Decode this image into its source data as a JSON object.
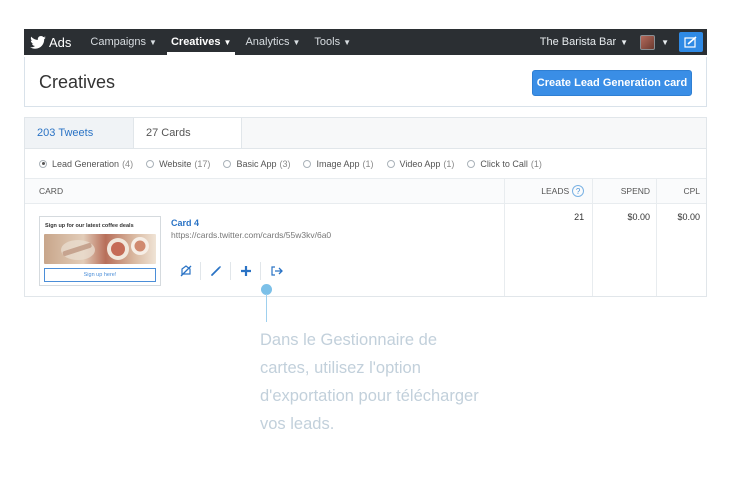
{
  "topbar": {
    "brand": "Ads",
    "nav": [
      {
        "label": "Campaigns"
      },
      {
        "label": "Creatives"
      },
      {
        "label": "Analytics"
      },
      {
        "label": "Tools"
      }
    ],
    "active_nav": "Creatives",
    "account_name": "The Barista Bar"
  },
  "header": {
    "title": "Creatives",
    "create_button": "Create Lead Generation card"
  },
  "tabs": [
    {
      "count": "203",
      "label": "Tweets"
    },
    {
      "count": "27",
      "label": "Cards"
    }
  ],
  "filters": [
    {
      "label": "Lead Generation",
      "count": "(4)",
      "selected": true
    },
    {
      "label": "Website",
      "count": "(17)",
      "selected": false
    },
    {
      "label": "Basic App",
      "count": "(3)",
      "selected": false
    },
    {
      "label": "Image App",
      "count": "(1)",
      "selected": false
    },
    {
      "label": "Video App",
      "count": "(1)",
      "selected": false
    },
    {
      "label": "Click to Call",
      "count": "(1)",
      "selected": false
    }
  ],
  "table": {
    "headers": {
      "card": "CARD",
      "leads": "LEADS",
      "spend": "SPEND",
      "cpl": "CPL"
    },
    "help_icon": "?",
    "rows": [
      {
        "name": "Card 4",
        "url": "https://cards.twitter.com/cards/55w3kv/6a0",
        "preview_title": "Sign up for our latest coffee deals",
        "preview_button": "Sign up here!",
        "leads": "21",
        "spend": "$0.00",
        "cpl": "$0.00"
      }
    ]
  },
  "callout": {
    "text": "Dans le Gestionnaire de cartes, utilisez l'option d'exportation pour télécharger vos leads."
  },
  "colors": {
    "topbar_bg": "#2b2f33",
    "accent_blue": "#3a8ee6",
    "link_blue": "#2a73c5",
    "callout_text": "#c2d0db",
    "callout_marker": "#7cc0e8"
  },
  "icons": [
    "twitter-bird-icon",
    "chevron-down-icon",
    "compose-icon",
    "help-icon",
    "toggle-off-icon",
    "edit-pencil-icon",
    "plus-icon",
    "export-icon"
  ]
}
